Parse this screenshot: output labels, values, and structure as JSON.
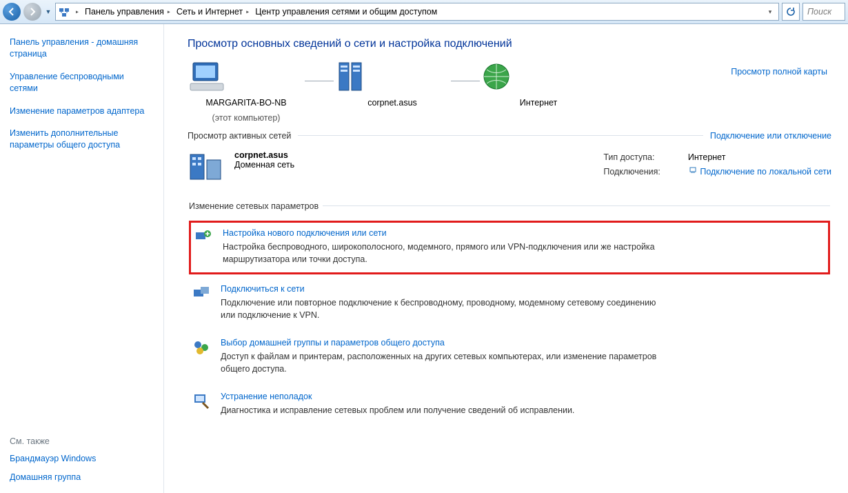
{
  "nav": {
    "back_icon": "back-icon",
    "fwd_icon": "forward-icon",
    "dropdown_icon": "chevron-down-icon"
  },
  "breadcrumb": {
    "items": [
      {
        "label": "Панель управления"
      },
      {
        "label": "Сеть и Интернет"
      },
      {
        "label": "Центр управления сетями и общим доступом"
      }
    ]
  },
  "toolbar": {
    "refresh_icon": "refresh-icon",
    "search_placeholder": "Поиск"
  },
  "sidebar": {
    "items": [
      {
        "label": "Панель управления - домашняя страница"
      },
      {
        "label": "Управление беспроводными сетями"
      },
      {
        "label": "Изменение параметров адаптера"
      },
      {
        "label": "Изменить дополнительные параметры общего доступа"
      }
    ],
    "see_also_label": "См. также",
    "see_also": [
      {
        "label": "Брандмауэр Windows"
      },
      {
        "label": "Домашняя группа"
      }
    ]
  },
  "main": {
    "title": "Просмотр основных сведений о сети и настройка подключений",
    "map": {
      "full_link": "Просмотр полной карты",
      "nodes": [
        {
          "label": "MARGARITA-BO-NB",
          "sub": "(этот компьютер)"
        },
        {
          "label": "corpnet.asus",
          "sub": ""
        },
        {
          "label": "Интернет",
          "sub": ""
        }
      ]
    },
    "active_section": {
      "label": "Просмотр активных сетей",
      "right_link": "Подключение или отключение"
    },
    "network": {
      "name": "corpnet.asus",
      "kind": "Доменная сеть",
      "rows": {
        "access_label": "Тип доступа:",
        "access_value": "Интернет",
        "conn_label": "Подключения:",
        "conn_value": "Подключение по локальной сети"
      }
    },
    "change_section_label": "Изменение сетевых параметров",
    "tasks": [
      {
        "link": "Настройка нового подключения или сети",
        "desc": "Настройка беспроводного, широкополосного, модемного, прямого или VPN-подключения или же настройка маршрутизатора или точки доступа.",
        "highlight": true
      },
      {
        "link": "Подключиться к сети",
        "desc": "Подключение или повторное подключение к беспроводному, проводному, модемному сетевому соединению или подключение к VPN.",
        "highlight": false
      },
      {
        "link": "Выбор домашней группы и параметров общего доступа",
        "desc": "Доступ к файлам и принтерам, расположенных на других сетевых компьютерах, или изменение параметров общего доступа.",
        "highlight": false
      },
      {
        "link": "Устранение неполадок",
        "desc": "Диагностика и исправление сетевых проблем или получение сведений об исправлении.",
        "highlight": false
      }
    ]
  }
}
